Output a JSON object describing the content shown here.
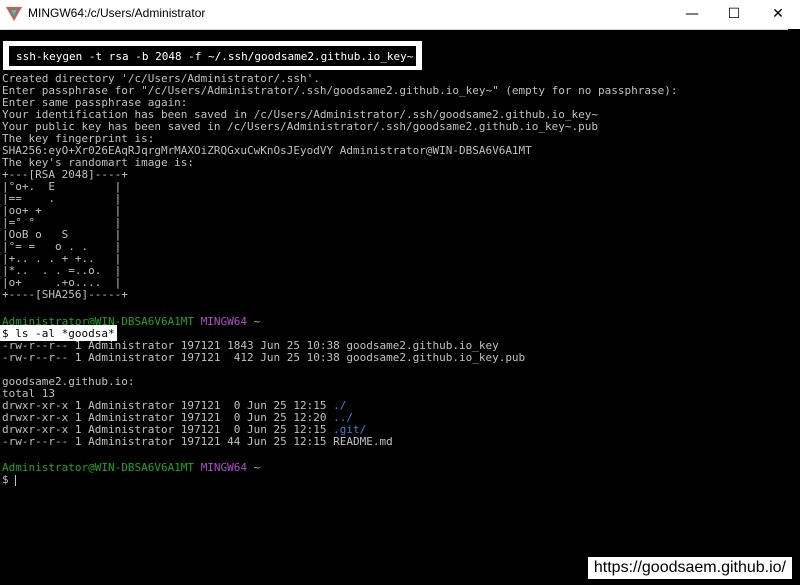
{
  "window": {
    "title": "MINGW64:/c/Users/Administrator",
    "minimize_glyph": "—",
    "maximize_glyph": "☐",
    "close_glyph": "✕"
  },
  "terminal": {
    "colors": {
      "default": "#c0c0c0",
      "prompt_user": "#1fa51f",
      "prompt_env": "#b24ccb",
      "prompt_path": "#c5c51f",
      "dir": "#4a7bd5",
      "background": "#000000"
    },
    "command1": "ssh-keygen -t rsa -b 2048 -f ~/.ssh/goodsame2.github.io_key~",
    "output1": [
      "Created directory '/c/Users/Administrator/.ssh'.",
      "Enter passphrase for \"/c/Users/Administrator/.ssh/goodsame2.github.io_key~\" (empty for no passphrase):",
      "Enter same passphrase again:",
      "Your identification has been saved in /c/Users/Administrator/.ssh/goodsame2.github.io_key~",
      "Your public key has been saved in /c/Users/Administrator/.ssh/goodsame2.github.io_key~.pub",
      "The key fingerprint is:",
      "SHA256:eyO+Xr026EAqRJqrgMrMAXOiZRQGxuCwKnOsJEyodVY Administrator@WIN-DBSA6V6A1MT",
      "The key's randomart image is:",
      "+---[RSA 2048]----+",
      "|°o+.  E         |",
      "|==    .         |",
      "|oo+ +           |",
      "|=° °            |",
      "|OoB o   S       |",
      "|°= =   o . .    |",
      "|+.. . . + +..   |",
      "|*..  . . =..o.  |",
      "|o+     .+o....  |",
      "+----[SHA256]-----+"
    ],
    "prompt1": {
      "user": "Administrator@WIN-DBSA6V6A1MT",
      "env": "MINGW64",
      "path": "~"
    },
    "command2": "$ ls -al *goodsa*",
    "output2": [
      "-rw-r--r-- 1 Administrator 197121 1843 Jun 25 10:38 goodsame2.github.io_key",
      "-rw-r--r-- 1 Administrator 197121  412 Jun 25 10:38 goodsame2.github.io_key.pub",
      "",
      "goodsame2.github.io:",
      "total 13"
    ],
    "dir_rows": [
      {
        "prefix": "drwxr-xr-x 1 Administrator 197121  0 Jun 25 12:15 ",
        "name": "./",
        "is_dir": true
      },
      {
        "prefix": "drwxr-xr-x 1 Administrator 197121  0 Jun 25 12:20 ",
        "name": "../",
        "is_dir": true
      },
      {
        "prefix": "drwxr-xr-x 1 Administrator 197121  0 Jun 25 12:15 ",
        "name": ".git/",
        "is_dir": true
      },
      {
        "prefix": "-rw-r--r-- 1 Administrator 197121 44 Jun 25 12:15 ",
        "name": "README.md",
        "is_dir": false
      }
    ],
    "prompt2": {
      "user": "Administrator@WIN-DBSA6V6A1MT",
      "env": "MINGW64",
      "path": "~"
    },
    "input_prompt": "$ "
  },
  "watermark": "https://goodsaem.github.io/"
}
